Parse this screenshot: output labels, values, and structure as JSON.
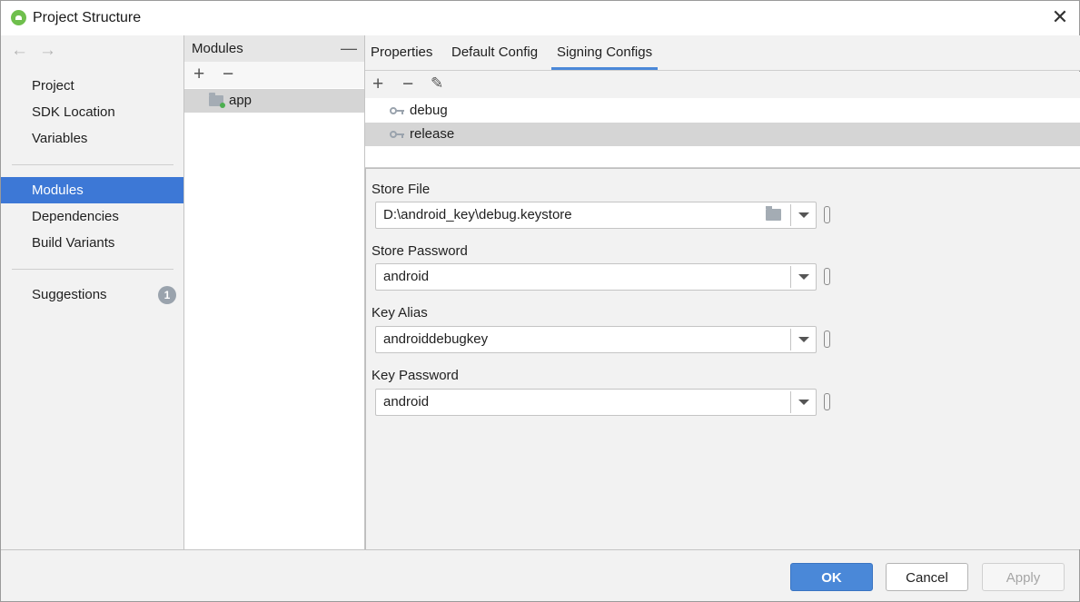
{
  "window": {
    "title": "Project Structure",
    "close_glyph": "✕"
  },
  "sidebar": {
    "back_glyph": "←",
    "forward_glyph": "→",
    "group1": [
      {
        "label": "Project"
      },
      {
        "label": "SDK Location"
      },
      {
        "label": "Variables"
      }
    ],
    "group2": [
      {
        "label": "Modules",
        "selected": true
      },
      {
        "label": "Dependencies"
      },
      {
        "label": "Build Variants"
      }
    ],
    "suggestions": {
      "label": "Suggestions",
      "badge": "1"
    }
  },
  "modules": {
    "header": "Modules",
    "collapse_glyph": "—",
    "add_glyph": "+",
    "remove_glyph": "−",
    "items": [
      {
        "label": "app",
        "selected": true
      }
    ]
  },
  "tabs": [
    {
      "label": "Properties"
    },
    {
      "label": "Default Config"
    },
    {
      "label": "Signing Configs",
      "active": true
    }
  ],
  "signing": {
    "add_glyph": "+",
    "remove_glyph": "−",
    "edit_glyph": "✎",
    "configs": [
      {
        "label": "debug"
      },
      {
        "label": "release",
        "selected": true
      }
    ]
  },
  "form": {
    "store_file": {
      "label": "Store File",
      "value": "D:\\android_key\\debug.keystore"
    },
    "store_password": {
      "label": "Store Password",
      "value": "android"
    },
    "key_alias": {
      "label": "Key Alias",
      "value": "androiddebugkey"
    },
    "key_password": {
      "label": "Key Password",
      "value": "android"
    }
  },
  "buttons": {
    "ok": "OK",
    "cancel": "Cancel",
    "apply": "Apply"
  },
  "colors": {
    "accent": "#3d78d6",
    "selection_gray": "#d5d5d5",
    "badge": "#9aa3ad"
  }
}
